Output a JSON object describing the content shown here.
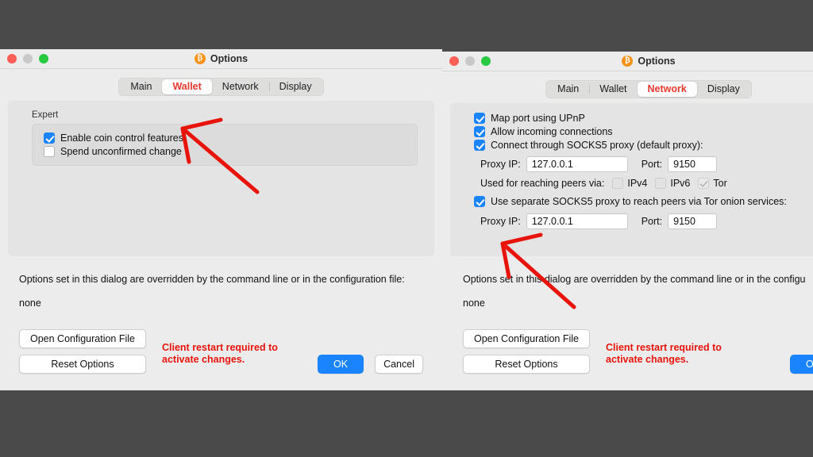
{
  "desktop": {
    "background_color": "#4a4a4a"
  },
  "windows": [
    {
      "id": "left",
      "title": "Options",
      "app_icon": "bitcoin-icon",
      "icon_glyph": "₿",
      "icon_color": "#f7931a",
      "traffic_lights": [
        "close",
        "minimize",
        "zoom"
      ],
      "tabs": [
        {
          "label": "Main",
          "active": false
        },
        {
          "label": "Wallet",
          "active": true
        },
        {
          "label": "Network",
          "active": false
        },
        {
          "label": "Display",
          "active": false
        }
      ],
      "group": {
        "title": "Expert",
        "checkboxes": [
          {
            "label": "Enable coin control features",
            "checked": true
          },
          {
            "label": "Spend unconfirmed change",
            "checked": false
          }
        ]
      },
      "footer": {
        "override_note": "Options set in this dialog are overridden by the command line or in the configuration file:",
        "override_value": "none",
        "open_config_label": "Open Configuration File",
        "reset_label": "Reset Options",
        "restart_warning": "Client restart required to\nactivate changes.",
        "ok_label": "OK",
        "cancel_label": "Cancel"
      }
    },
    {
      "id": "right",
      "title": "Options",
      "app_icon": "bitcoin-icon",
      "icon_glyph": "₿",
      "icon_color": "#f7931a",
      "traffic_lights": [
        "close",
        "minimize",
        "zoom"
      ],
      "tabs": [
        {
          "label": "Main",
          "active": false
        },
        {
          "label": "Wallet",
          "active": false
        },
        {
          "label": "Network",
          "active": true
        },
        {
          "label": "Display",
          "active": false
        }
      ],
      "network": {
        "checkboxes": [
          {
            "label": "Map port using UPnP",
            "checked": true
          },
          {
            "label": "Allow incoming connections",
            "checked": true
          },
          {
            "label": "Connect through SOCKS5 proxy (default proxy):",
            "checked": true
          }
        ],
        "proxy": {
          "ip_label": "Proxy IP:",
          "ip_value": "127.0.0.1",
          "port_label": "Port:",
          "port_value": "9150"
        },
        "peers_label": "Used for reaching peers via:",
        "peer_options": [
          {
            "label": "IPv4",
            "checked": false,
            "enabled": true
          },
          {
            "label": "IPv6",
            "checked": false,
            "enabled": true
          },
          {
            "label": "Tor",
            "checked": true,
            "enabled": false
          }
        ],
        "onion_checkbox": {
          "label": "Use separate SOCKS5 proxy to reach peers via Tor onion services:",
          "checked": true
        },
        "onion_proxy": {
          "ip_label": "Proxy IP:",
          "ip_value": "127.0.0.1",
          "port_label": "Port:",
          "port_value": "9150"
        }
      },
      "footer": {
        "override_note": "Options set in this dialog are overridden by the command line or in the configu",
        "override_value": "none",
        "open_config_label": "Open Configuration File",
        "reset_label": "Reset Options",
        "restart_warning": "Client restart required to\nactivate changes.",
        "ok_label": "OK"
      }
    }
  ],
  "annotations": {
    "arrow_color": "#e8140b",
    "arrow_count": 2
  }
}
